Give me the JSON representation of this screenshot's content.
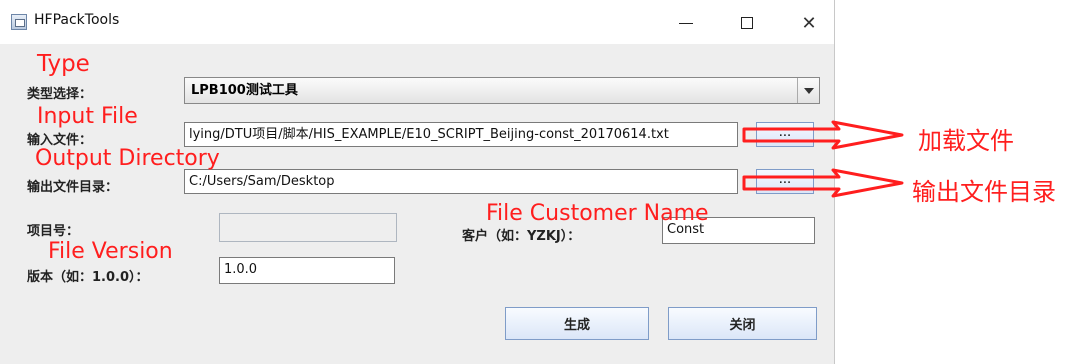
{
  "window": {
    "title": "HFPackTools"
  },
  "controls": {
    "minimize_icon": "minimize-icon",
    "maximize_icon": "maximize-icon",
    "close_icon": "close-icon"
  },
  "form": {
    "type_label": "类型选择：",
    "type_value": "LPB100测试工具",
    "input_file_label": "输入文件：",
    "input_file_value": "lying/DTU项目/脚本/HIS_EXAMPLE/E10_SCRIPT_Beijing-const_20170614.txt",
    "browse_input_label": "...",
    "output_dir_label": "输出文件目录：",
    "output_dir_value": "C:/Users/Sam/Desktop",
    "browse_output_label": "...",
    "project_no_label": "项目号：",
    "project_no_value": "",
    "customer_label": "客户（如：YZKJ）：",
    "customer_value": "Const",
    "version_label": "版本（如：1.0.0）：",
    "version_value": "1.0.0"
  },
  "buttons": {
    "generate": "生成",
    "close": "关闭"
  },
  "annotations": {
    "type": "Type",
    "input_file": "Input File",
    "output_directory": "Output Directory",
    "file_customer_name": "File Customer Name",
    "file_version": "File Version",
    "load_file": "加载文件",
    "output_dir": "输出文件目录"
  },
  "annotation_color": "#ff1e1e"
}
